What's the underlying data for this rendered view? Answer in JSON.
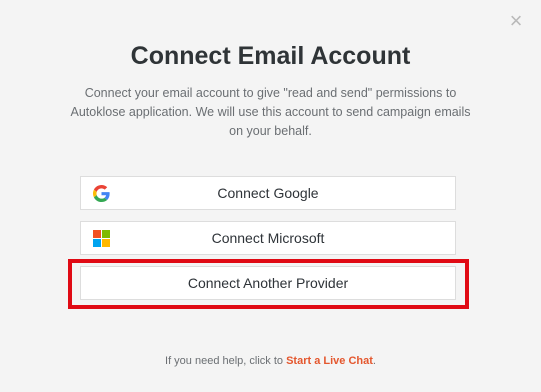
{
  "dialog": {
    "close_glyph": "×",
    "title": "Connect Email Account",
    "description": "Connect your email account to give \"read and send\" permissions to Autoklose application. We will use this account to send campaign emails on your behalf."
  },
  "buttons": {
    "google": {
      "label": "Connect Google",
      "icon": "google-icon"
    },
    "microsoft": {
      "label": "Connect Microsoft",
      "icon": "microsoft-icon"
    },
    "other": {
      "label": "Connect Another Provider"
    }
  },
  "help": {
    "prefix": "If you need help, click to",
    "link": "Start a Live Chat",
    "suffix": "."
  },
  "colors": {
    "highlight": "#e00a14",
    "link": "#e4572e",
    "ms_red": "#f25022",
    "ms_green": "#7fba00",
    "ms_blue": "#00a4ef",
    "ms_yellow": "#ffb900"
  }
}
